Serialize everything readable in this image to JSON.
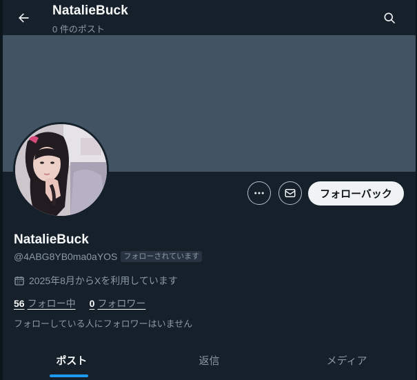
{
  "header": {
    "title": "NatalieBuck",
    "post_count": "0 件のポスト",
    "back_icon": "arrow-left-icon",
    "search_icon": "search-icon"
  },
  "profile": {
    "display_name": "NatalieBuck",
    "handle": "@4ABG8YB0ma0aYOS",
    "follows_you_badge": "フォローされています",
    "joined": "2025年8月からXを利用しています",
    "following_count": "56",
    "following_label": "フォロー中",
    "followers_count": "0",
    "followers_label": "フォロワー",
    "no_mutual_followers": "フォローしている人にフォロワーはいません"
  },
  "actions": {
    "more_icon": "more-icon",
    "message_icon": "envelope-icon",
    "follow_back_label": "フォローバック"
  },
  "tabs": [
    {
      "label": "ポスト",
      "active": true
    },
    {
      "label": "返信",
      "active": false
    },
    {
      "label": "メディア",
      "active": false
    }
  ],
  "colors": {
    "background": "#15202b",
    "banner": "#425364",
    "accent": "#1d9bf0",
    "secondary_text": "#8b98a5"
  }
}
